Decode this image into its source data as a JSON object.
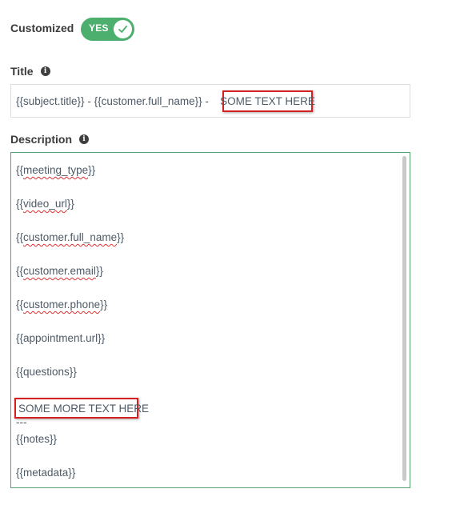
{
  "customized": {
    "label": "Customized",
    "toggle_text": "YES",
    "icon": "check-icon",
    "accent": "#4caf6e"
  },
  "title_section": {
    "label": "Title",
    "info_icon": "info-icon",
    "value_prefix": "{{subject.title}} - {{customer.full_name}} -",
    "highlight_text": "SOME TEXT HERE",
    "highlight_color": "#d42020"
  },
  "description_section": {
    "label": "Description",
    "info_icon": "info-icon",
    "lines": {
      "meeting_type_open": "{{",
      "meeting_type_word": "meeting_type",
      "meeting_type_close": "}}",
      "video_url_open": "{{",
      "video_url_word": "video_url",
      "video_url_close": "}}",
      "customer_full_name_open": "{{",
      "customer_full_name_word": "customer.full_name",
      "customer_full_name_close": "}}",
      "customer_email_open": "{{",
      "customer_email_word": "customer.email",
      "customer_email_close": "}}",
      "customer_phone_open": "{{",
      "customer_phone_word": "customer.phone",
      "customer_phone_close": "}}",
      "appointment_url": "{{appointment.url}}",
      "questions": "{{questions}}",
      "highlight_text": "SOME MORE TEXT HERE",
      "separator": "---",
      "notes": "{{notes}}",
      "metadata": "{{metadata}}"
    }
  }
}
